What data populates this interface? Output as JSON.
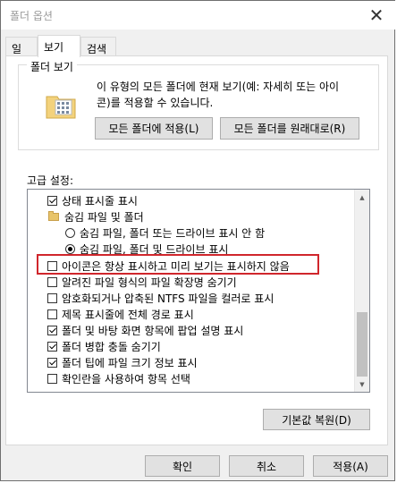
{
  "window": {
    "title": "폴더 옵션",
    "close_icon": "close-icon"
  },
  "tabs": [
    {
      "label": "일반",
      "active": false
    },
    {
      "label": "보기",
      "active": true
    },
    {
      "label": "검색",
      "active": false
    }
  ],
  "folder_view": {
    "group_title": "폴더 보기",
    "description_line1": "이 유형의 모든 폴더에 현재 보기(예: 자세히 또는 아이",
    "description_line2": "콘)를 적용할 수 있습니다.",
    "apply_button": "모든 폴더에 적용(L)",
    "reset_button": "모든 폴더를 원래대로(R)"
  },
  "advanced": {
    "label": "고급 설정:",
    "items": [
      {
        "type": "checkbox",
        "checked": true,
        "label": "상태 표시줄 표시",
        "indent": 1
      },
      {
        "type": "folder",
        "label": "숨김 파일 및 폴더",
        "indent": 1
      },
      {
        "type": "radio",
        "checked": false,
        "label": "숨김 파일, 폴더 또는 드라이브 표시 안 함",
        "indent": 2
      },
      {
        "type": "radio",
        "checked": true,
        "label": "숨김 파일, 폴더 및 드라이브 표시",
        "indent": 2
      },
      {
        "type": "checkbox",
        "checked": false,
        "label": "아이콘은 항상 표시하고 미리 보기는 표시하지 않음",
        "indent": 1
      },
      {
        "type": "checkbox",
        "checked": false,
        "label": "알려진 파일 형식의 파일 확장명 숨기기",
        "indent": 1
      },
      {
        "type": "checkbox",
        "checked": false,
        "label": "암호화되거나 압축된 NTFS 파일을 컬러로 표시",
        "indent": 1
      },
      {
        "type": "checkbox",
        "checked": false,
        "label": "제목 표시줄에 전체 경로 표시",
        "indent": 1
      },
      {
        "type": "checkbox",
        "checked": true,
        "label": "폴더 및 바탕 화면 항목에 팝업 설명 표시",
        "indent": 1
      },
      {
        "type": "checkbox",
        "checked": true,
        "label": "폴더 병합 충돌 숨기기",
        "indent": 1
      },
      {
        "type": "checkbox",
        "checked": true,
        "label": "폴더 팁에 파일 크기 정보 표시",
        "indent": 1
      },
      {
        "type": "checkbox",
        "checked": false,
        "label": "확인란을 사용하여 항목 선택",
        "indent": 1
      }
    ],
    "restore_button": "기본값 복원(D)"
  },
  "footer": {
    "ok": "확인",
    "cancel": "취소",
    "apply": "적용(A)"
  },
  "colors": {
    "highlight": "#d0262c",
    "accent": "#0078d7"
  }
}
